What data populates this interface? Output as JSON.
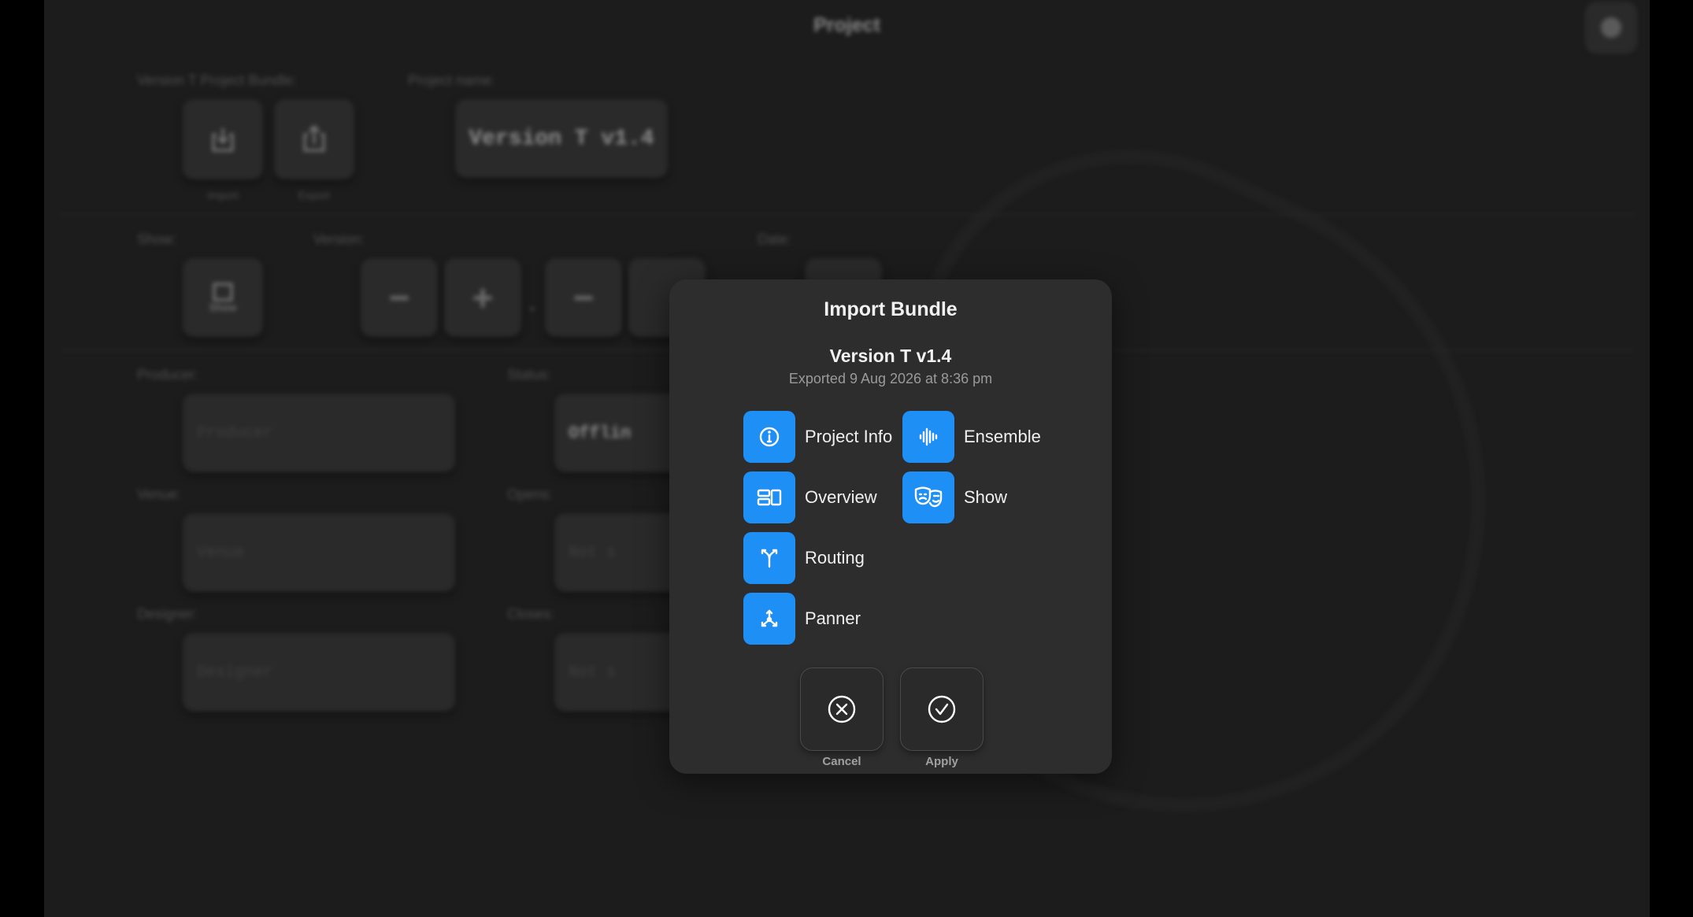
{
  "background": {
    "title": "Project",
    "bundle_label": "Version T Project Bundle:",
    "import_label": "Import",
    "export_label": "Export",
    "project_name_label": "Project name:",
    "project_name_value": "Version T v1.4",
    "show_label": "Show:",
    "show_button_label": "Show",
    "version_label": "Version:",
    "version_separator": ".",
    "date_label": "Date:",
    "producer_label": "Producer:",
    "producer_placeholder": "Producer",
    "status_label": "Status:",
    "status_value": "Offlin",
    "venue_label": "Venue:",
    "venue_placeholder": "Venue",
    "opens_label": "Opens:",
    "opens_value": "Not s",
    "designer_label": "Designer:",
    "designer_placeholder": "Designer",
    "closes_label": "Closes:",
    "closes_value": "Not s"
  },
  "modal": {
    "title": "Import Bundle",
    "bundle_name": "Version T v1.4",
    "exported": "Exported 9 Aug 2026 at 8:36 pm",
    "options": [
      {
        "label": "Project Info",
        "icon": "info-icon"
      },
      {
        "label": "Ensemble",
        "icon": "waveform-icon"
      },
      {
        "label": "Overview",
        "icon": "overview-icon"
      },
      {
        "label": "Show",
        "icon": "theater-masks-icon"
      },
      {
        "label": "Routing",
        "icon": "routing-icon"
      },
      {
        "label": "Panner",
        "icon": "panner-icon"
      }
    ],
    "cancel_label": "Cancel",
    "apply_label": "Apply",
    "accent_color": "#1e8ff5"
  }
}
